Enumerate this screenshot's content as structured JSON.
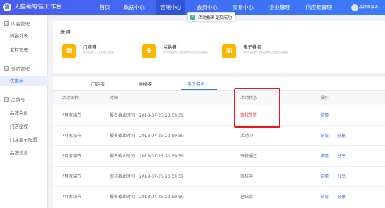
{
  "header": {
    "logo_glyph": "猫",
    "app_title": "天猫新零售工作台",
    "nav": [
      {
        "label": "首页"
      },
      {
        "label": "数据中心"
      },
      {
        "label": "营销中心"
      },
      {
        "label": "会员中心"
      },
      {
        "label": "交易中心"
      },
      {
        "label": "企业管理"
      },
      {
        "label": "供应链管理"
      }
    ],
    "active_nav": "营销中心",
    "user_name": "品牌商家名",
    "accent_color": "#3f6ff5"
  },
  "toast": {
    "icon": "check-icon",
    "text": "活动报名提交成功"
  },
  "sidebar": {
    "groups": [
      {
        "label": "内容管理",
        "icon": "content-icon",
        "items": [
          {
            "label": "内容列表"
          },
          {
            "label": "素材管理"
          }
        ]
      },
      {
        "label": "营销管理",
        "icon": "marketing-icon",
        "items": [
          {
            "label": "优惠券"
          }
        ]
      },
      {
        "label": "品牌号",
        "icon": "brand-icon",
        "items": [
          {
            "label": "品牌会员"
          },
          {
            "label": "门店授权"
          },
          {
            "label": "门店展示配置"
          },
          {
            "label": "品牌信息"
          }
        ]
      }
    ],
    "active_item": "优惠券"
  },
  "main": {
    "section_title": "新建",
    "cards": [
      {
        "title": "门店券",
        "desc": "适用于线下门店的优惠券",
        "icon": "store-icon"
      },
      {
        "title": "兑换券",
        "desc": "用户在规定门店兑换商品的凭证券券",
        "icon": "gift-icon"
      },
      {
        "title": "电子券包",
        "desc": "用户在规定门店兑换商品的凭证券券",
        "icon": "wallet-icon"
      }
    ],
    "tabs": [
      {
        "label": "门店券"
      },
      {
        "label": "兑换券"
      },
      {
        "label": "电子券包"
      }
    ],
    "active_tab": "电子券包",
    "table": {
      "headers": [
        "活动名称",
        "时间",
        "活动状态",
        "操作"
      ],
      "rows": [
        {
          "name": "7月家装节",
          "time": "报名截止时间：2018-07-25 23:59:59",
          "status": "审核失败",
          "actions": [
            "详情"
          ]
        },
        {
          "name": "7月家装节",
          "time": "报名截止时间：2018-07-25 23:59:59",
          "status": "活动中",
          "actions": [
            "详情",
            "分享"
          ]
        },
        {
          "name": "7月家装节",
          "time": "报名截止时间：2018-07-25 23:59:59",
          "status": "审核通过",
          "actions": [
            "详情",
            "分享"
          ]
        },
        {
          "name": "7月家装节",
          "time": "审核截止时间：2018-07-25 23:59:59",
          "status": "审核中",
          "actions": [
            "详情",
            "分享"
          ]
        },
        {
          "name": "7月家装节",
          "time": "报名截止时间：2018-07-25 23:59:59",
          "status": "已结束",
          "actions": [
            "详情",
            "分享"
          ]
        }
      ]
    },
    "highlight_color": "#e31c1c",
    "fail_color": "#e8202a"
  }
}
